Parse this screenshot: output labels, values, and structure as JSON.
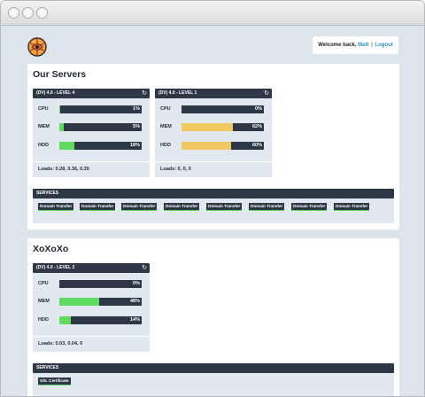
{
  "header": {
    "welcome_text": "Welcome back,",
    "user_name": "Matt",
    "separator": "|",
    "logout_label": "Logout"
  },
  "colors": {
    "header_dark": "#2e3745",
    "bar_green": "#5fdc5f",
    "bar_yellow": "#f2c961",
    "link_blue": "#2f8fc6",
    "background": "#dde4ec"
  },
  "icons": {
    "logo": "logo-icon",
    "refresh": "refresh-icon"
  },
  "groups": [
    {
      "title": "Our Servers",
      "servers": [
        {
          "name": "(DV) 4.0 - LEVEL 4",
          "metrics": [
            {
              "label": "CPU",
              "value_text": "1%",
              "value": 1,
              "color": "#5fdc5f"
            },
            {
              "label": "MEM",
              "value_text": "5%",
              "value": 5,
              "color": "#5fdc5f"
            },
            {
              "label": "HDD",
              "value_text": "18%",
              "value": 18,
              "color": "#5fdc5f"
            }
          ],
          "loads": "Loads: 0.28, 0.36, 0.35"
        },
        {
          "name": "(DV) 4.0 - LEVEL 1",
          "metrics": [
            {
              "label": "CPU",
              "value_text": "0%",
              "value": 0,
              "color": "#5fdc5f"
            },
            {
              "label": "MEM",
              "value_text": "62%",
              "value": 62,
              "color": "#f2c961"
            },
            {
              "label": "HDD",
              "value_text": "60%",
              "value": 60,
              "color": "#f2c961"
            }
          ],
          "loads": "Loads: 0, 0, 0"
        }
      ],
      "services_label": "SERVICES",
      "services": [
        "Domain Transfer",
        "Domain Transfer",
        "Domain Transfer",
        "Domain Transfer",
        "Domain Transfer",
        "Domain Transfer",
        "Domain Transfer",
        "Domain Transfer"
      ]
    },
    {
      "title": "XoXoXo",
      "servers": [
        {
          "name": "(DV) 4.0 - LEVEL 2",
          "metrics": [
            {
              "label": "CPU",
              "value_text": "0%",
              "value": 0,
              "color": "#5fdc5f"
            },
            {
              "label": "MEM",
              "value_text": "48%",
              "value": 48,
              "color": "#5fdc5f"
            },
            {
              "label": "HDD",
              "value_text": "14%",
              "value": 14,
              "color": "#5fdc5f"
            }
          ],
          "loads": "Loads: 0.03, 0.04, 0"
        }
      ],
      "services_label": "SERVICES",
      "services": [
        "SSL Certificate"
      ]
    }
  ]
}
